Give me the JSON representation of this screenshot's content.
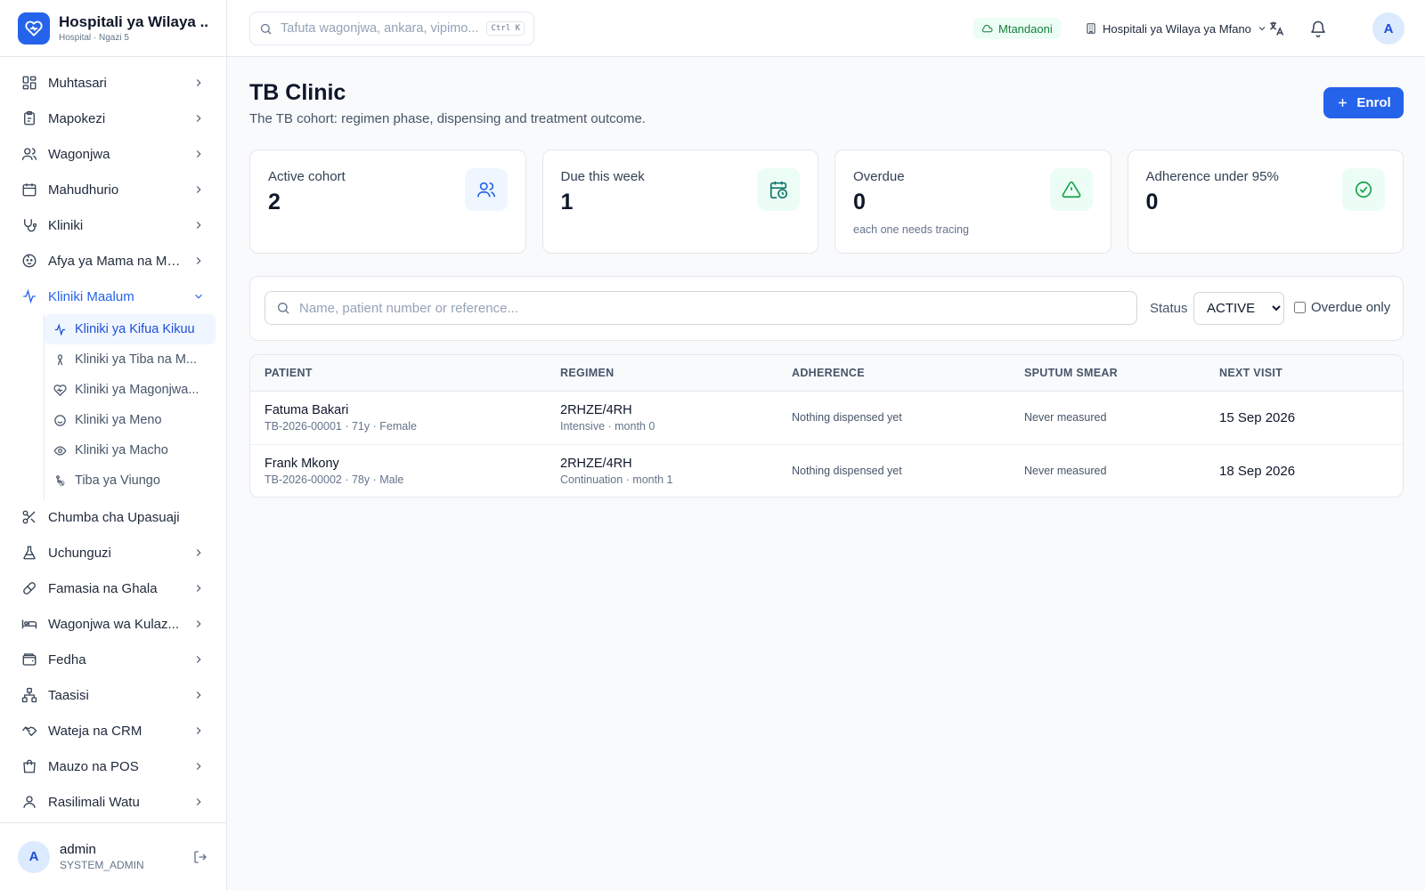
{
  "brand": {
    "title": "Hospitali ya Wilaya ...",
    "subtitle": "Hospital · Ngazi 5"
  },
  "sidebar": {
    "items": [
      {
        "label": "Muhtasari",
        "icon": "dashboard-icon"
      },
      {
        "label": "Mapokezi",
        "icon": "clipboard-icon"
      },
      {
        "label": "Wagonjwa",
        "icon": "users-icon"
      },
      {
        "label": "Mahudhurio",
        "icon": "calendar-icon"
      },
      {
        "label": "Kliniki",
        "icon": "stethoscope-icon"
      },
      {
        "label": "Afya ya Mama na Mt...",
        "icon": "baby-icon"
      },
      {
        "label": "Kliniki Maalum",
        "icon": "activity-icon"
      }
    ],
    "subitems": [
      {
        "label": "Kliniki ya Kifua Kikuu",
        "icon": "activity-icon"
      },
      {
        "label": "Kliniki ya Tiba na M...",
        "icon": "ribbon-icon"
      },
      {
        "label": "Kliniki ya Magonjwa...",
        "icon": "heart-pulse-icon"
      },
      {
        "label": "Kliniki ya Meno",
        "icon": "smile-icon"
      },
      {
        "label": "Kliniki ya Macho",
        "icon": "eye-icon"
      },
      {
        "label": "Tiba ya Viungo",
        "icon": "accessibility-icon"
      }
    ],
    "items_after": [
      {
        "label": "Chumba cha Upasuaji",
        "icon": "scissors-icon"
      },
      {
        "label": "Uchunguzi",
        "icon": "flask-icon"
      },
      {
        "label": "Famasia na Ghala",
        "icon": "pill-icon"
      },
      {
        "label": "Wagonjwa wa Kulaz...",
        "icon": "bed-icon"
      },
      {
        "label": "Fedha",
        "icon": "wallet-icon"
      },
      {
        "label": "Taasisi",
        "icon": "network-icon"
      },
      {
        "label": "Wateja na CRM",
        "icon": "handshake-icon"
      },
      {
        "label": "Mauzo na POS",
        "icon": "shopping-bag-icon"
      },
      {
        "label": "Rasilimali Watu",
        "icon": "user-icon"
      }
    ]
  },
  "user": {
    "initial": "A",
    "name": "admin",
    "role": "SYSTEM_ADMIN"
  },
  "header": {
    "search_placeholder": "Tafuta wagonjwa, ankara, vipimo...",
    "shortcut": "Ctrl K",
    "online_label": "Mtandaoni",
    "facility": "Hospitali ya Wilaya ya Mfano",
    "avatar_initial": "A"
  },
  "page": {
    "title": "TB Clinic",
    "subtitle": "The TB cohort: regimen phase, dispensing and treatment outcome.",
    "enrol_label": "Enrol"
  },
  "cards": [
    {
      "label": "Active cohort",
      "value": "2",
      "note": "",
      "icon": "users-icon",
      "bg": "#eff6ff",
      "color": "#2563eb"
    },
    {
      "label": "Due this week",
      "value": "1",
      "note": "",
      "icon": "calendar-clock-icon",
      "bg": "#ecfdf5",
      "color": "#0f766e"
    },
    {
      "label": "Overdue",
      "value": "0",
      "note": "each one needs tracing",
      "icon": "alert-triangle-icon",
      "bg": "#ecfdf5",
      "color": "#16a34a"
    },
    {
      "label": "Adherence under 95%",
      "value": "0",
      "note": "",
      "icon": "check-circle-icon",
      "bg": "#ecfdf5",
      "color": "#16a34a"
    }
  ],
  "filter": {
    "search_placeholder": "Name, patient number or reference...",
    "status_label": "Status",
    "status_value": "ACTIVE",
    "overdue_label": "Overdue only"
  },
  "table": {
    "columns": [
      "PATIENT",
      "REGIMEN",
      "ADHERENCE",
      "SPUTUM SMEAR",
      "NEXT VISIT"
    ],
    "rows": [
      {
        "name": "Fatuma Bakari",
        "meta": "TB-2026-00001 · 71y · Female",
        "regimen": "2RHZE/4RH",
        "phase": "Intensive · month 0",
        "adherence": "Nothing dispensed yet",
        "smear": "Never measured",
        "next_visit": "15 Sep 2026"
      },
      {
        "name": "Frank Mkony",
        "meta": "TB-2026-00002 · 78y · Male",
        "regimen": "2RHZE/4RH",
        "phase": "Continuation · month 1",
        "adherence": "Nothing dispensed yet",
        "smear": "Never measured",
        "next_visit": "18 Sep 2026"
      }
    ]
  },
  "colors": {
    "accent": "#2563eb",
    "online": "#15803d"
  }
}
